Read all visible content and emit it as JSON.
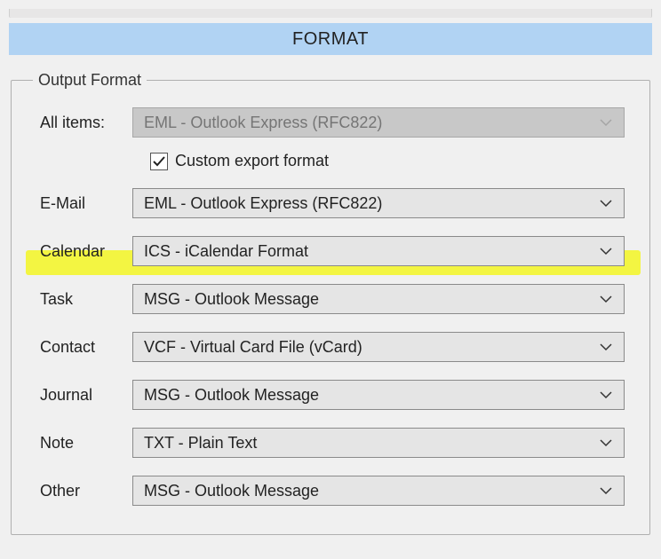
{
  "header": {
    "title": "FORMAT"
  },
  "group": {
    "legend": "Output Format"
  },
  "allItems": {
    "label": "All items:",
    "value": "EML - Outlook Express (RFC822)"
  },
  "customExport": {
    "checked": true,
    "label": "Custom export format"
  },
  "rows": {
    "email": {
      "label": "E-Mail",
      "value": "EML - Outlook Express (RFC822)"
    },
    "calendar": {
      "label": "Calendar",
      "value": "ICS - iCalendar Format"
    },
    "task": {
      "label": "Task",
      "value": "MSG - Outlook Message"
    },
    "contact": {
      "label": "Contact",
      "value": "VCF - Virtual Card File (vCard)"
    },
    "journal": {
      "label": "Journal",
      "value": "MSG - Outlook Message"
    },
    "note": {
      "label": "Note",
      "value": "TXT - Plain Text"
    },
    "other": {
      "label": "Other",
      "value": "MSG - Outlook Message"
    }
  }
}
